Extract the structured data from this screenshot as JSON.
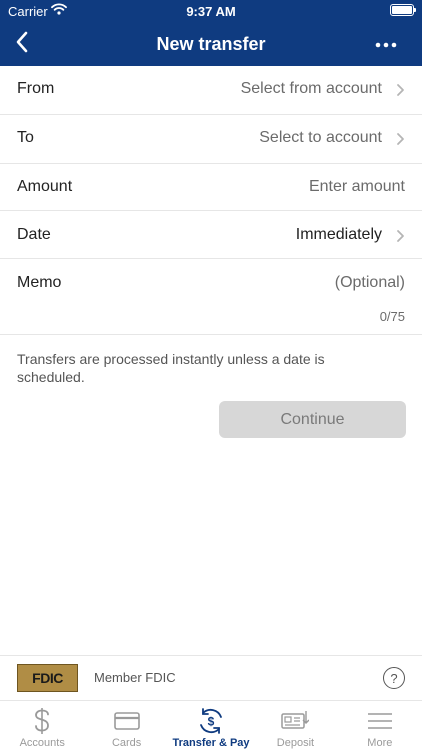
{
  "status_bar": {
    "carrier": "Carrier",
    "time": "9:37 AM"
  },
  "nav": {
    "title": "New transfer",
    "back_icon": "chevron-left-icon",
    "more_icon": "ellipsis-icon"
  },
  "form": {
    "from_label": "From",
    "from_value": "Select from account",
    "to_label": "To",
    "to_value": "Select to account",
    "amount_label": "Amount",
    "amount_placeholder": "Enter amount",
    "date_label": "Date",
    "date_value": "Immediately",
    "memo_label": "Memo",
    "memo_placeholder": "(Optional)",
    "memo_counter": "0/75"
  },
  "info_text": "Transfers are processed instantly unless a date is scheduled.",
  "continue_label": "Continue",
  "fdic": {
    "logo_text": "FDIC",
    "label": "Member FDIC",
    "help": "?"
  },
  "tabs": [
    {
      "label": "Accounts",
      "icon": "dollar-icon",
      "active": false
    },
    {
      "label": "Cards",
      "icon": "card-icon",
      "active": false
    },
    {
      "label": "Transfer & Pay",
      "icon": "transfer-pay-icon",
      "active": true
    },
    {
      "label": "Deposit",
      "icon": "check-deposit-icon",
      "active": false
    },
    {
      "label": "More",
      "icon": "menu-icon",
      "active": false
    }
  ],
  "colors": {
    "brand": "#0f3b80",
    "inactive_tab": "#9a9a9a",
    "button_disabled": "#d7d7d7"
  }
}
